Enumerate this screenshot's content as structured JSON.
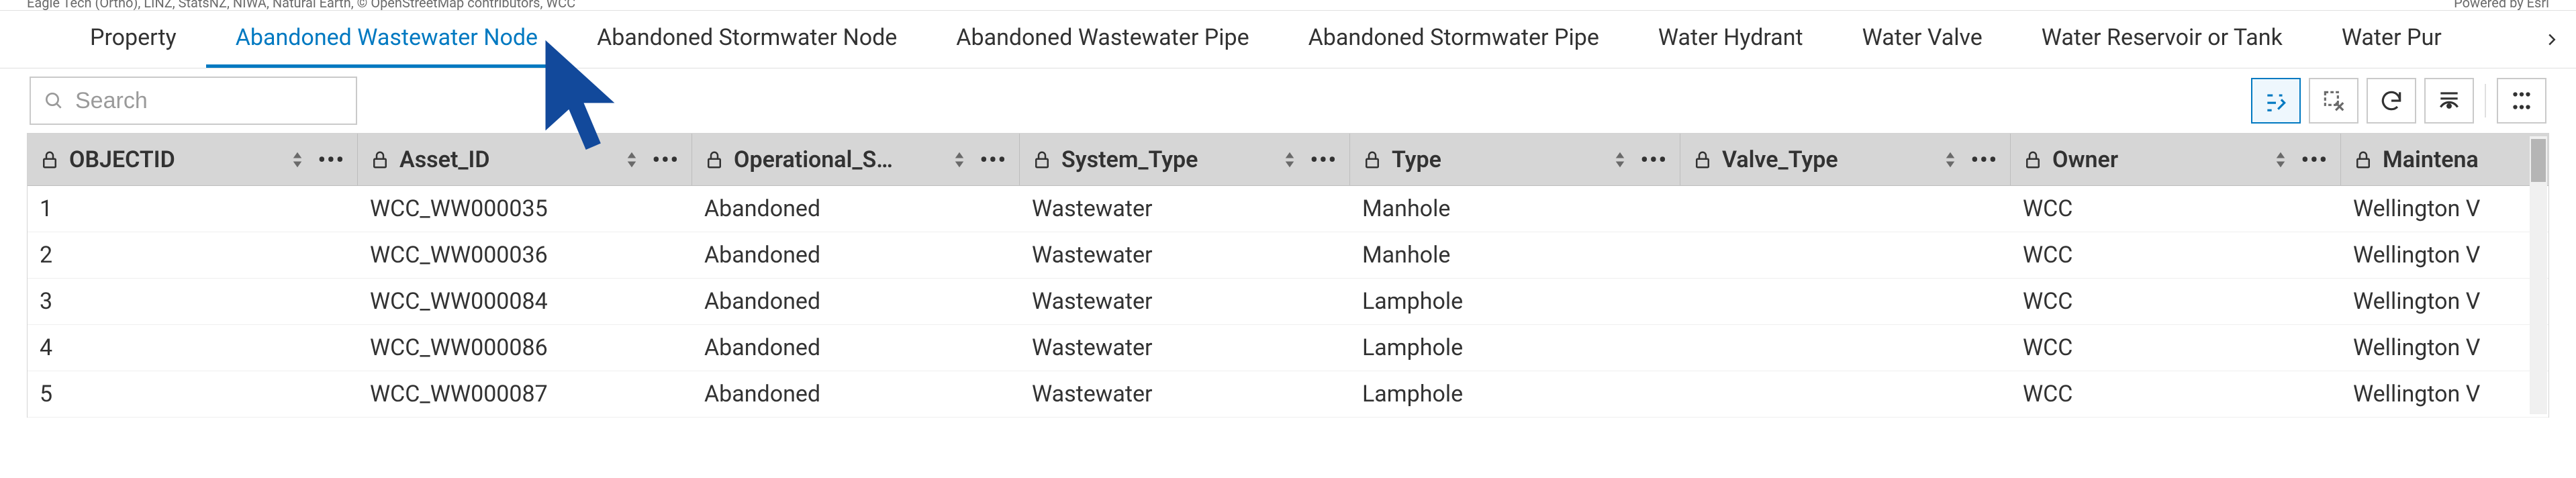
{
  "attribution": {
    "left": "Eagle Tech (Ortho), LINZ, StatsNZ, NIWA, Natural Earth, © OpenStreetMap contributors, WCC",
    "right": "Powered by Esri"
  },
  "tabs": [
    {
      "label": "Property",
      "active": false
    },
    {
      "label": "Abandoned Wastewater Node",
      "active": true
    },
    {
      "label": "Abandoned Stormwater Node",
      "active": false
    },
    {
      "label": "Abandoned Wastewater Pipe",
      "active": false
    },
    {
      "label": "Abandoned Stormwater Pipe",
      "active": false
    },
    {
      "label": "Water Hydrant",
      "active": false
    },
    {
      "label": "Water Valve",
      "active": false
    },
    {
      "label": "Water Reservoir or Tank",
      "active": false
    },
    {
      "label": "Water Pur",
      "active": false
    }
  ],
  "search": {
    "placeholder": "Search",
    "value": ""
  },
  "toolbar_icons": {
    "filter_selection": "filter-by-selection-icon",
    "clear_selection": "clear-selection-icon",
    "refresh": "refresh-icon",
    "show_hide": "show-hide-columns-icon",
    "app_launcher": "app-launcher-icon"
  },
  "columns": [
    {
      "key": "obj",
      "label": "OBJECTID",
      "cls": "c-obj"
    },
    {
      "key": "asset",
      "label": "Asset_ID",
      "cls": "c-asset"
    },
    {
      "key": "ops",
      "label": "Operational_S…",
      "cls": "c-ops"
    },
    {
      "key": "sys",
      "label": "System_Type",
      "cls": "c-sys"
    },
    {
      "key": "type",
      "label": "Type",
      "cls": "c-type"
    },
    {
      "key": "valve",
      "label": "Valve_Type",
      "cls": "c-valve"
    },
    {
      "key": "owner",
      "label": "Owner",
      "cls": "c-owner"
    },
    {
      "key": "maint",
      "label": "Maintena",
      "cls": "c-maint"
    }
  ],
  "rows": [
    {
      "obj": "1",
      "asset": "WCC_WW000035",
      "ops": "Abandoned",
      "sys": "Wastewater",
      "type": "Manhole",
      "valve": "",
      "owner": "WCC",
      "maint": "Wellington V"
    },
    {
      "obj": "2",
      "asset": "WCC_WW000036",
      "ops": "Abandoned",
      "sys": "Wastewater",
      "type": "Manhole",
      "valve": "",
      "owner": "WCC",
      "maint": "Wellington V"
    },
    {
      "obj": "3",
      "asset": "WCC_WW000084",
      "ops": "Abandoned",
      "sys": "Wastewater",
      "type": "Lamphole",
      "valve": "",
      "owner": "WCC",
      "maint": "Wellington V"
    },
    {
      "obj": "4",
      "asset": "WCC_WW000086",
      "ops": "Abandoned",
      "sys": "Wastewater",
      "type": "Lamphole",
      "valve": "",
      "owner": "WCC",
      "maint": "Wellington V"
    },
    {
      "obj": "5",
      "asset": "WCC_WW000087",
      "ops": "Abandoned",
      "sys": "Wastewater",
      "type": "Lamphole",
      "valve": "",
      "owner": "WCC",
      "maint": "Wellington V"
    }
  ]
}
